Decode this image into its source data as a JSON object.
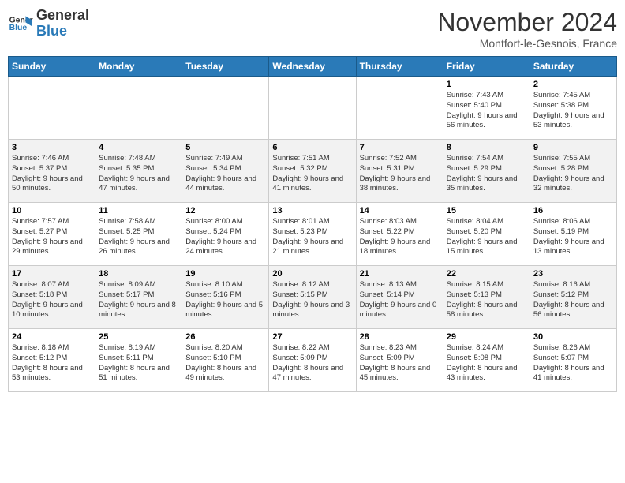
{
  "logo": {
    "line1": "General",
    "line2": "Blue"
  },
  "title": "November 2024",
  "subtitle": "Montfort-le-Gesnois, France",
  "days_of_week": [
    "Sunday",
    "Monday",
    "Tuesday",
    "Wednesday",
    "Thursday",
    "Friday",
    "Saturday"
  ],
  "weeks": [
    [
      {
        "day": "",
        "detail": ""
      },
      {
        "day": "",
        "detail": ""
      },
      {
        "day": "",
        "detail": ""
      },
      {
        "day": "",
        "detail": ""
      },
      {
        "day": "",
        "detail": ""
      },
      {
        "day": "1",
        "detail": "Sunrise: 7:43 AM\nSunset: 5:40 PM\nDaylight: 9 hours and 56 minutes."
      },
      {
        "day": "2",
        "detail": "Sunrise: 7:45 AM\nSunset: 5:38 PM\nDaylight: 9 hours and 53 minutes."
      }
    ],
    [
      {
        "day": "3",
        "detail": "Sunrise: 7:46 AM\nSunset: 5:37 PM\nDaylight: 9 hours and 50 minutes."
      },
      {
        "day": "4",
        "detail": "Sunrise: 7:48 AM\nSunset: 5:35 PM\nDaylight: 9 hours and 47 minutes."
      },
      {
        "day": "5",
        "detail": "Sunrise: 7:49 AM\nSunset: 5:34 PM\nDaylight: 9 hours and 44 minutes."
      },
      {
        "day": "6",
        "detail": "Sunrise: 7:51 AM\nSunset: 5:32 PM\nDaylight: 9 hours and 41 minutes."
      },
      {
        "day": "7",
        "detail": "Sunrise: 7:52 AM\nSunset: 5:31 PM\nDaylight: 9 hours and 38 minutes."
      },
      {
        "day": "8",
        "detail": "Sunrise: 7:54 AM\nSunset: 5:29 PM\nDaylight: 9 hours and 35 minutes."
      },
      {
        "day": "9",
        "detail": "Sunrise: 7:55 AM\nSunset: 5:28 PM\nDaylight: 9 hours and 32 minutes."
      }
    ],
    [
      {
        "day": "10",
        "detail": "Sunrise: 7:57 AM\nSunset: 5:27 PM\nDaylight: 9 hours and 29 minutes."
      },
      {
        "day": "11",
        "detail": "Sunrise: 7:58 AM\nSunset: 5:25 PM\nDaylight: 9 hours and 26 minutes."
      },
      {
        "day": "12",
        "detail": "Sunrise: 8:00 AM\nSunset: 5:24 PM\nDaylight: 9 hours and 24 minutes."
      },
      {
        "day": "13",
        "detail": "Sunrise: 8:01 AM\nSunset: 5:23 PM\nDaylight: 9 hours and 21 minutes."
      },
      {
        "day": "14",
        "detail": "Sunrise: 8:03 AM\nSunset: 5:22 PM\nDaylight: 9 hours and 18 minutes."
      },
      {
        "day": "15",
        "detail": "Sunrise: 8:04 AM\nSunset: 5:20 PM\nDaylight: 9 hours and 15 minutes."
      },
      {
        "day": "16",
        "detail": "Sunrise: 8:06 AM\nSunset: 5:19 PM\nDaylight: 9 hours and 13 minutes."
      }
    ],
    [
      {
        "day": "17",
        "detail": "Sunrise: 8:07 AM\nSunset: 5:18 PM\nDaylight: 9 hours and 10 minutes."
      },
      {
        "day": "18",
        "detail": "Sunrise: 8:09 AM\nSunset: 5:17 PM\nDaylight: 9 hours and 8 minutes."
      },
      {
        "day": "19",
        "detail": "Sunrise: 8:10 AM\nSunset: 5:16 PM\nDaylight: 9 hours and 5 minutes."
      },
      {
        "day": "20",
        "detail": "Sunrise: 8:12 AM\nSunset: 5:15 PM\nDaylight: 9 hours and 3 minutes."
      },
      {
        "day": "21",
        "detail": "Sunrise: 8:13 AM\nSunset: 5:14 PM\nDaylight: 9 hours and 0 minutes."
      },
      {
        "day": "22",
        "detail": "Sunrise: 8:15 AM\nSunset: 5:13 PM\nDaylight: 8 hours and 58 minutes."
      },
      {
        "day": "23",
        "detail": "Sunrise: 8:16 AM\nSunset: 5:12 PM\nDaylight: 8 hours and 56 minutes."
      }
    ],
    [
      {
        "day": "24",
        "detail": "Sunrise: 8:18 AM\nSunset: 5:12 PM\nDaylight: 8 hours and 53 minutes."
      },
      {
        "day": "25",
        "detail": "Sunrise: 8:19 AM\nSunset: 5:11 PM\nDaylight: 8 hours and 51 minutes."
      },
      {
        "day": "26",
        "detail": "Sunrise: 8:20 AM\nSunset: 5:10 PM\nDaylight: 8 hours and 49 minutes."
      },
      {
        "day": "27",
        "detail": "Sunrise: 8:22 AM\nSunset: 5:09 PM\nDaylight: 8 hours and 47 minutes."
      },
      {
        "day": "28",
        "detail": "Sunrise: 8:23 AM\nSunset: 5:09 PM\nDaylight: 8 hours and 45 minutes."
      },
      {
        "day": "29",
        "detail": "Sunrise: 8:24 AM\nSunset: 5:08 PM\nDaylight: 8 hours and 43 minutes."
      },
      {
        "day": "30",
        "detail": "Sunrise: 8:26 AM\nSunset: 5:07 PM\nDaylight: 8 hours and 41 minutes."
      }
    ]
  ]
}
